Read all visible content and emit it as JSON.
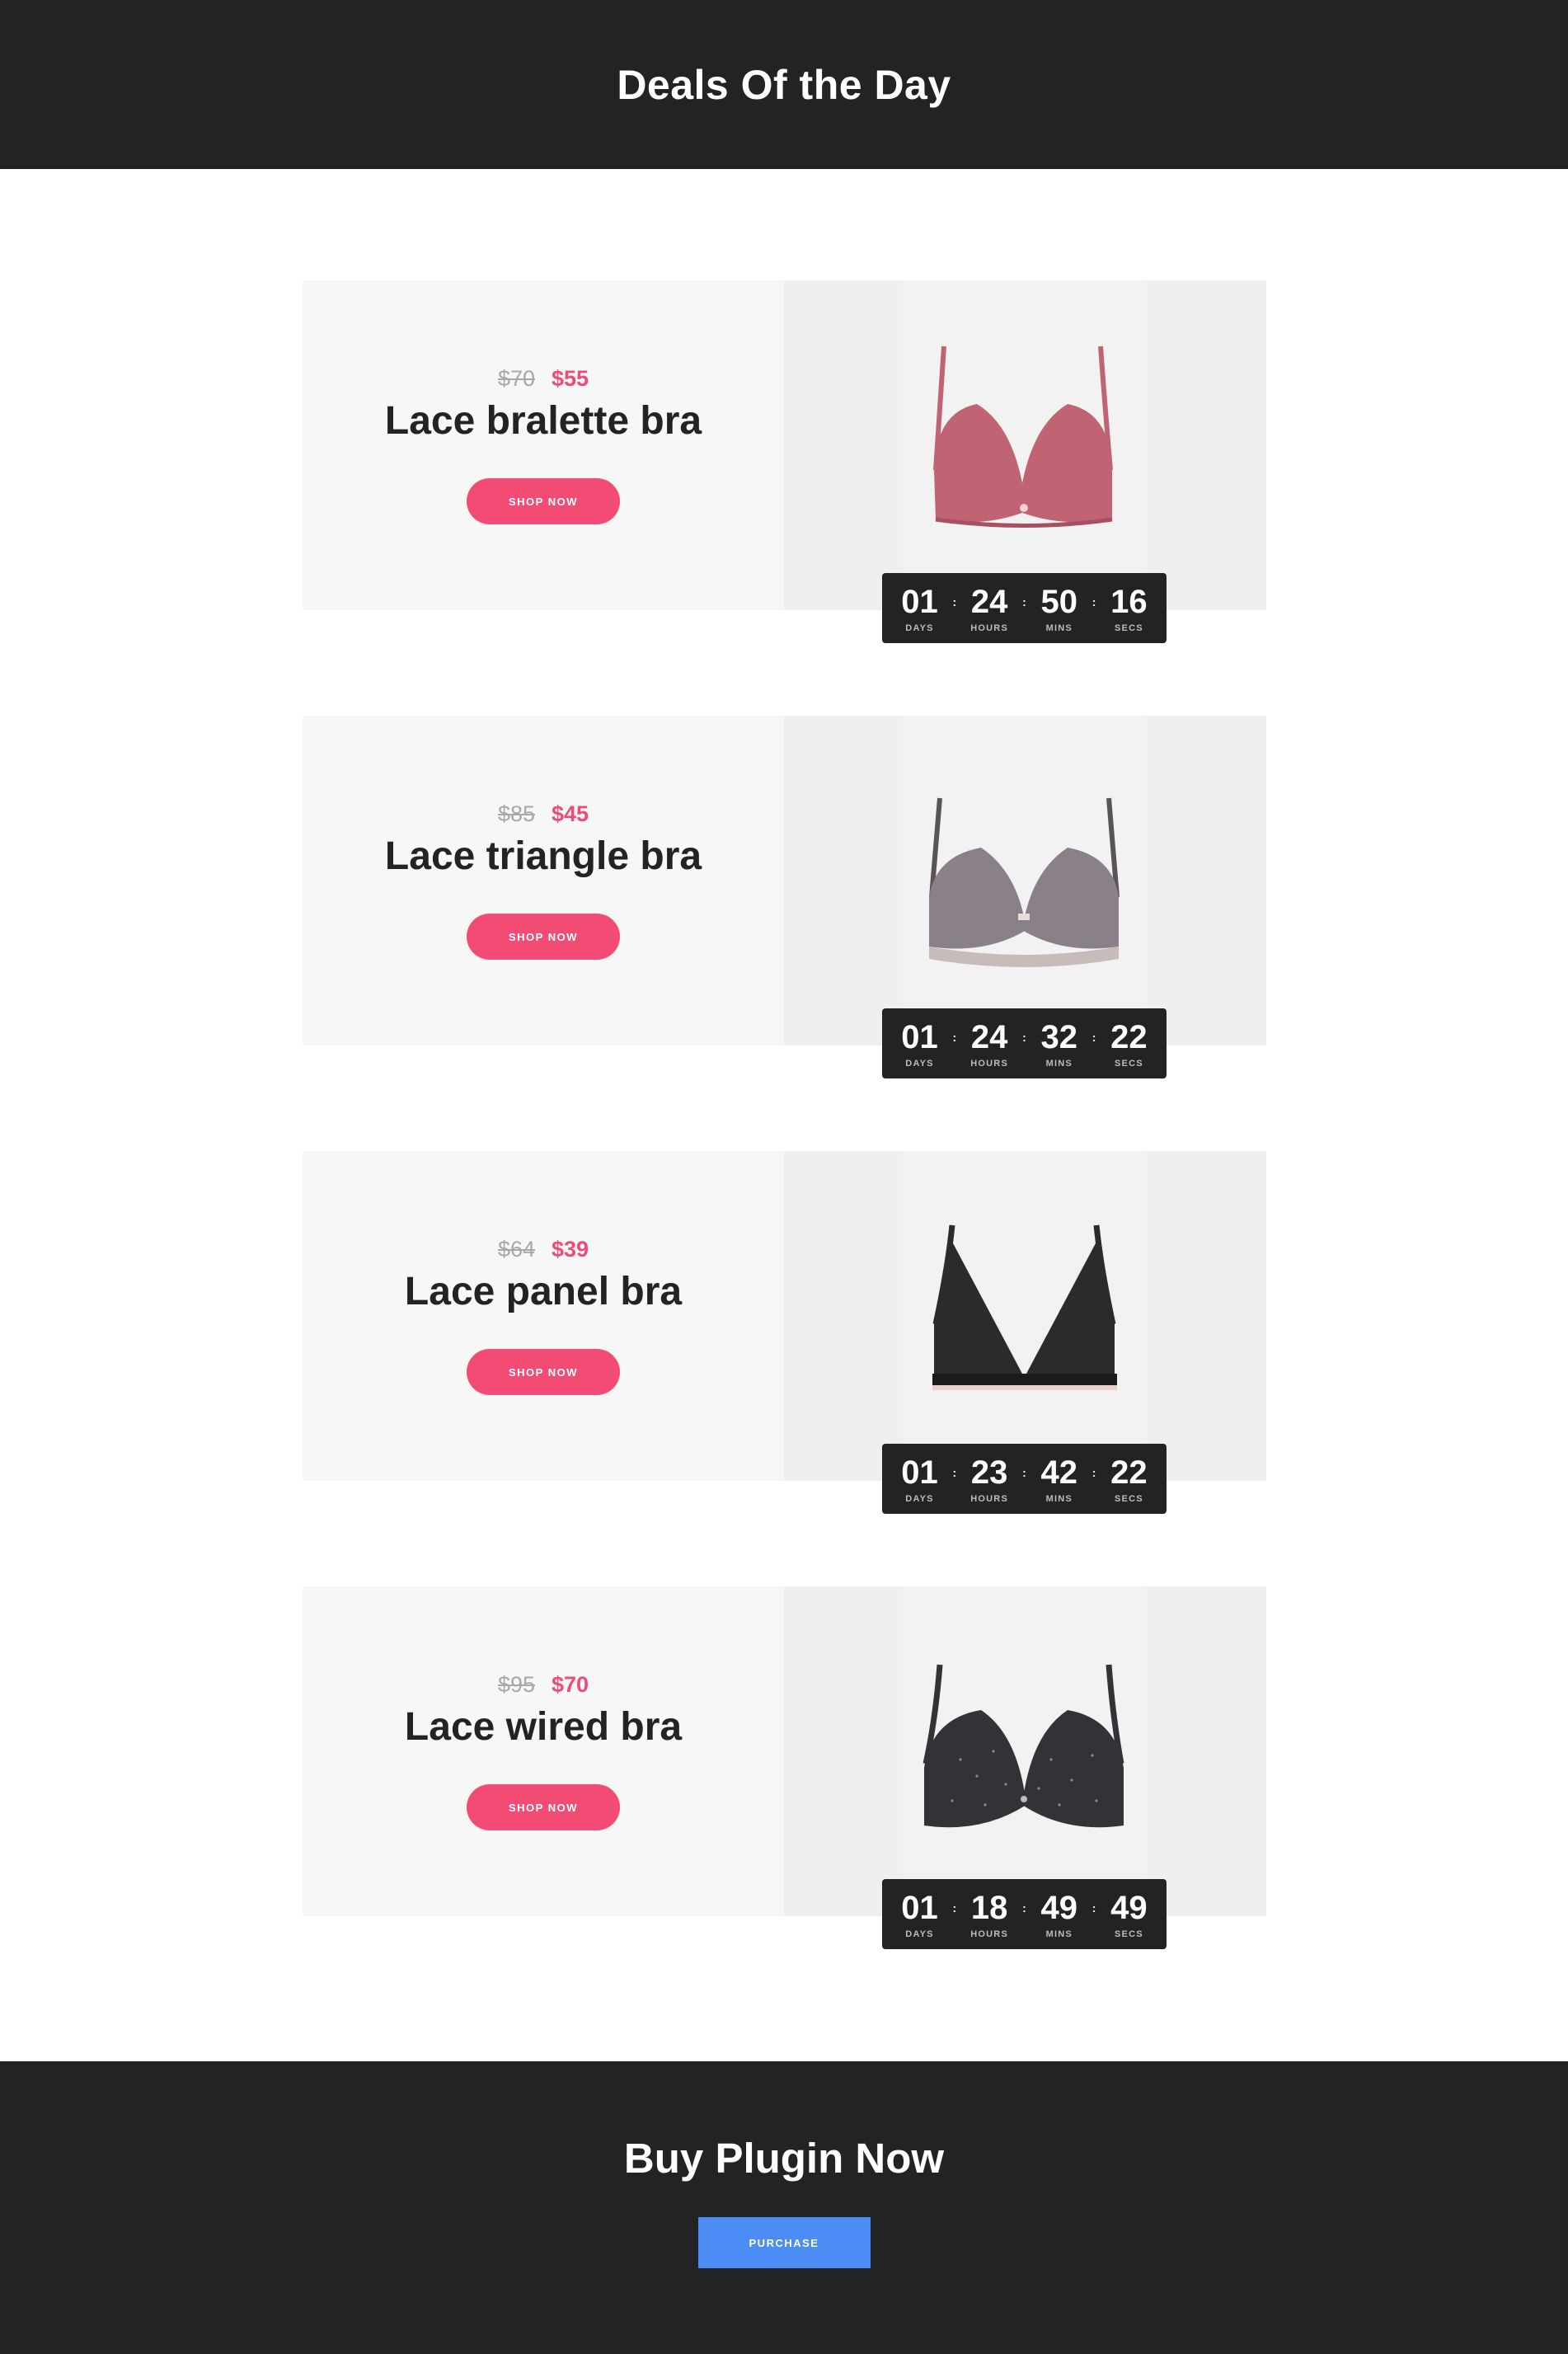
{
  "header": {
    "title": "Deals Of the Day"
  },
  "deals": [
    {
      "old_price": "$70",
      "new_price": "$55",
      "title": "Lace bralette bra",
      "button": "SHOP NOW",
      "timer": {
        "days": "01",
        "hours": "24",
        "mins": "50",
        "secs": "16"
      },
      "product_color": "#c06474",
      "product": "pink lace bra"
    },
    {
      "old_price": "$85",
      "new_price": "$45",
      "title": "Lace triangle bra",
      "button": "SHOP NOW",
      "timer": {
        "days": "01",
        "hours": "24",
        "mins": "32",
        "secs": "22"
      },
      "product_color": "#8a808a",
      "product": "grey lace bra"
    },
    {
      "old_price": "$64",
      "new_price": "$39",
      "title": "Lace panel bra",
      "button": "SHOP NOW",
      "timer": {
        "days": "01",
        "hours": "23",
        "mins": "42",
        "secs": "22"
      },
      "product_color": "#2b2b2d",
      "product": "black lace triangle bra"
    },
    {
      "old_price": "$95",
      "new_price": "$70",
      "title": "Lace wired bra",
      "button": "SHOP NOW",
      "timer": {
        "days": "01",
        "hours": "18",
        "mins": "49",
        "secs": "49"
      },
      "product_color": "#333337",
      "product": "dark polka dot bra"
    }
  ],
  "timer_labels": {
    "days": "DAYS",
    "hours": "HOURS",
    "mins": "MINS",
    "secs": "SECS"
  },
  "footer": {
    "title": "Buy Plugin Now",
    "button": "PURCHASE"
  },
  "colors": {
    "dark": "#222325",
    "accent_pink": "#f24c74",
    "accent_blue": "#4c8cf5"
  }
}
